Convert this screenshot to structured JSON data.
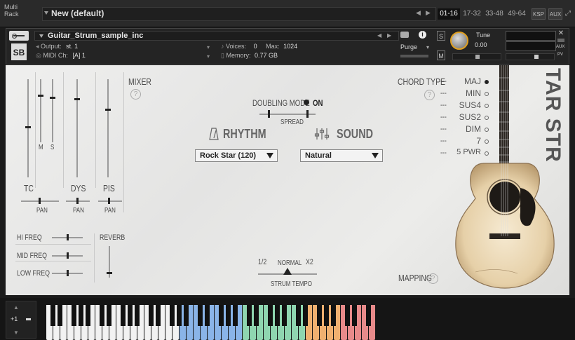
{
  "rack": {
    "label_line1": "Multi",
    "label_line2": "Rack",
    "preset_name": "New (default)",
    "tabs": [
      "01-16",
      "17-32",
      "33-48",
      "49-64"
    ],
    "ksp": "KSP",
    "aux": "AUX"
  },
  "instrument": {
    "name": "Guitar_Strum_sample_inc",
    "output_label": "Output:",
    "output_value": "st. 1",
    "midi_label": "MIDI Ch:",
    "midi_value": "[A] 1",
    "voices_label": "Voices:",
    "voices_value": "0",
    "max_label": "Max:",
    "max_value": "1024",
    "memory_label": "Memory:",
    "memory_value": "0.77 GB",
    "purge": "Purge",
    "tune_label": "Tune",
    "tune_value": "0.00",
    "s_btn": "S",
    "m_btn": "M",
    "logo": "SB",
    "aux_btn": "AUX",
    "pv_btn": "PV"
  },
  "mixer": {
    "title": "MIXER",
    "help": "?",
    "m": "M",
    "s": "S",
    "channels": [
      "TC",
      "DYS",
      "PIS"
    ],
    "pan": "PAN",
    "eq": [
      "HI FREQ",
      "MID FREQ",
      "LOW FREQ"
    ],
    "reverb": "REVERB"
  },
  "doubling": {
    "label": "DOUBLING MODE",
    "state": "ON",
    "spread": "SPREAD"
  },
  "rhythm": {
    "title": "RHYTHM",
    "value": "Rock Star (120)"
  },
  "sound": {
    "title": "SOUND",
    "value": "Natural"
  },
  "chord": {
    "title": "CHORD TYPE",
    "help": "?",
    "types": [
      "MAJ",
      "MIN",
      "SUS4",
      "SUS2",
      "DIM",
      "7",
      "5 PWR"
    ],
    "dashes": "---",
    "selected_index": 0
  },
  "tempo": {
    "half": "1/2",
    "normal": "NORMAL",
    "double": "X2",
    "label": "STRUM TEMPO"
  },
  "mapping": {
    "label": "MAPPING",
    "help": "?"
  },
  "brand": {
    "text": "TAR STRUM"
  },
  "keyboard": {
    "octave_up": "+1",
    "colors": {
      "blue": "#8ab4e8",
      "green": "#8fd6b0",
      "orange": "#f0b070",
      "red": "#e88a8a"
    }
  }
}
